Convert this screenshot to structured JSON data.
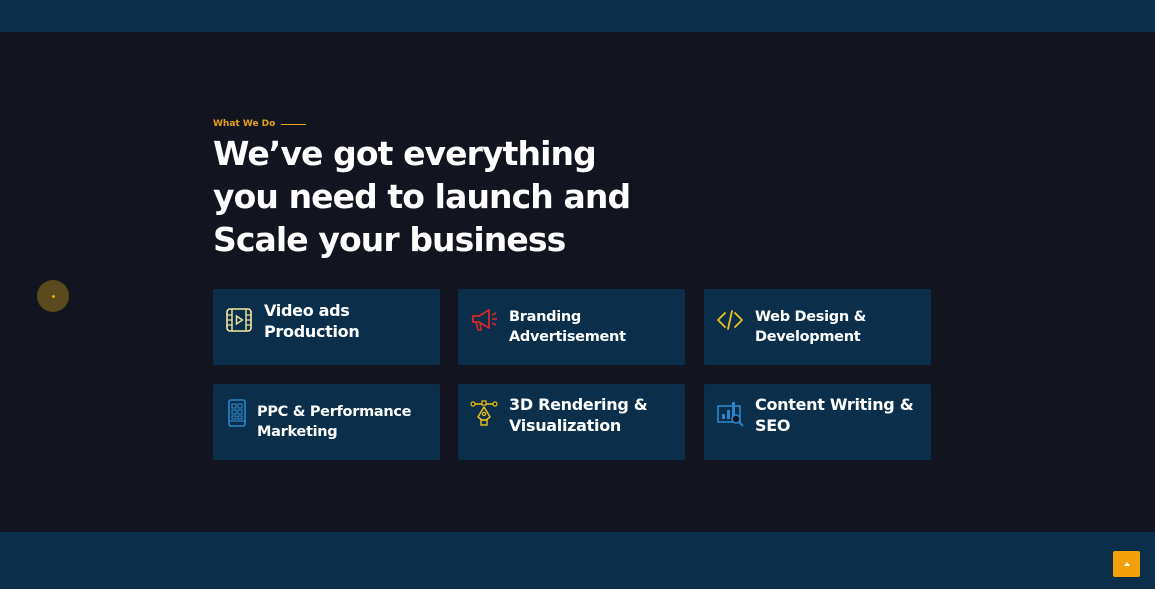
{
  "section": {
    "eyebrow": "What We Do",
    "headline_lines": [
      "We’ve got everything",
      "you need to launch and",
      "Scale your business"
    ]
  },
  "services": [
    {
      "icon": "video-icon",
      "color": "#f4e6a2",
      "lines": [
        "Video ads",
        "Production"
      ]
    },
    {
      "icon": "megaphone-icon",
      "color": "#d42a2a",
      "lines": [
        "Branding",
        "Advertisement"
      ]
    },
    {
      "icon": "code-icon",
      "color": "#f0c21b",
      "lines": [
        "Web Design &",
        "Development"
      ]
    },
    {
      "icon": "mobile-icon",
      "color": "#2a86c9",
      "lines": [
        "PPC & Performance",
        "Marketing"
      ]
    },
    {
      "icon": "pen-tool-icon",
      "color": "#f0c21b",
      "lines": [
        "3D Rendering &",
        "Visualization"
      ]
    },
    {
      "icon": "analytics-icon",
      "color": "#2a86c9",
      "lines": [
        "Content Writing &",
        "SEO"
      ]
    }
  ],
  "colors": {
    "accent": "#e8a11a",
    "band": "#0b2f4a",
    "background": "#12151f"
  }
}
